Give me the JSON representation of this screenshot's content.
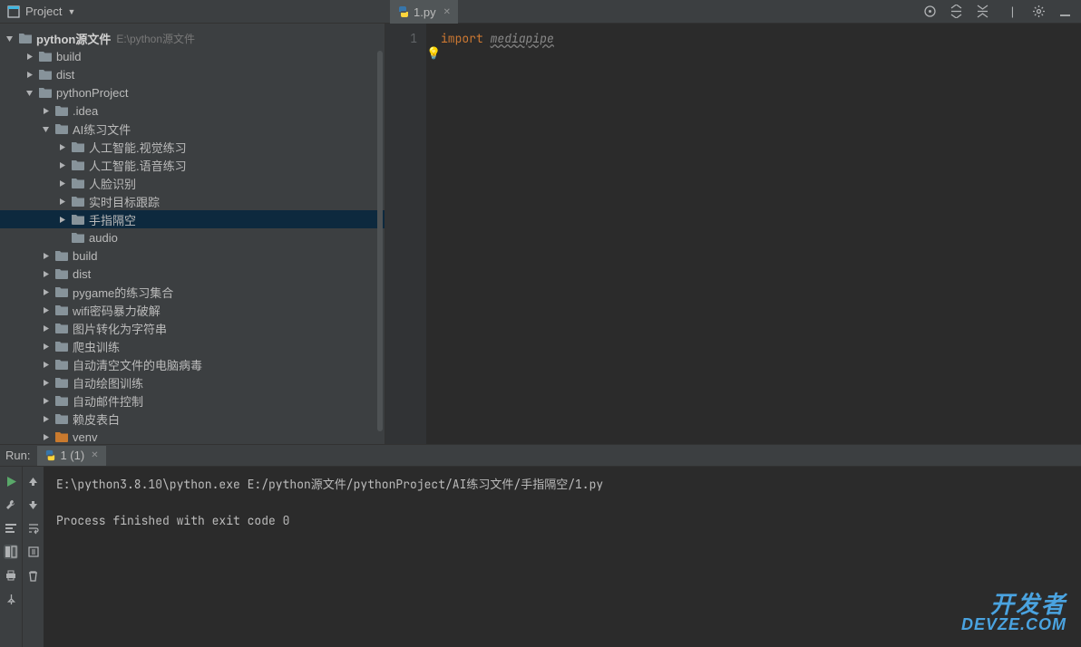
{
  "toolbar": {
    "project_label": "Project"
  },
  "editor_tab": {
    "label": "1.py"
  },
  "tree": {
    "root": {
      "label": "python源文件",
      "path": "E:\\python源文件"
    },
    "items": [
      {
        "indent": 1,
        "arrow": "right",
        "label": "build"
      },
      {
        "indent": 1,
        "arrow": "right",
        "label": "dist"
      },
      {
        "indent": 1,
        "arrow": "down",
        "label": "pythonProject"
      },
      {
        "indent": 2,
        "arrow": "right",
        "label": ".idea"
      },
      {
        "indent": 2,
        "arrow": "down",
        "label": "AI练习文件"
      },
      {
        "indent": 3,
        "arrow": "right",
        "label": "人工智能.视觉练习"
      },
      {
        "indent": 3,
        "arrow": "right",
        "label": "人工智能.语音练习"
      },
      {
        "indent": 3,
        "arrow": "right",
        "label": "人脸识别"
      },
      {
        "indent": 3,
        "arrow": "right",
        "label": "实时目标跟踪"
      },
      {
        "indent": 3,
        "arrow": "right",
        "label": "手指隔空",
        "selected": true
      },
      {
        "indent": 3,
        "arrow": "",
        "label": "audio"
      },
      {
        "indent": 2,
        "arrow": "right",
        "label": "build"
      },
      {
        "indent": 2,
        "arrow": "right",
        "label": "dist"
      },
      {
        "indent": 2,
        "arrow": "right",
        "label": "pygame的练习集合"
      },
      {
        "indent": 2,
        "arrow": "right",
        "label": "wifi密码暴力破解"
      },
      {
        "indent": 2,
        "arrow": "right",
        "label": "图片转化为字符串"
      },
      {
        "indent": 2,
        "arrow": "right",
        "label": "爬虫训练"
      },
      {
        "indent": 2,
        "arrow": "right",
        "label": "自动清空文件的电脑病毒"
      },
      {
        "indent": 2,
        "arrow": "right",
        "label": "自动绘图训练"
      },
      {
        "indent": 2,
        "arrow": "right",
        "label": "自动邮件控制"
      },
      {
        "indent": 2,
        "arrow": "right",
        "label": "赖皮表白"
      },
      {
        "indent": 2,
        "arrow": "right",
        "label": "venv",
        "venv": true
      }
    ]
  },
  "editor": {
    "line_number": "1",
    "keyword": "import",
    "module": "mediapipe"
  },
  "run": {
    "label": "Run:",
    "tab": "1 (1)",
    "line1": "E:\\python3.8.10\\python.exe E:/python源文件/pythonProject/AI练习文件/手指隔空/1.py",
    "line2": "Process finished with exit code 0"
  },
  "watermark": {
    "line1": "开发者",
    "line2": "DEVZE.COM"
  }
}
